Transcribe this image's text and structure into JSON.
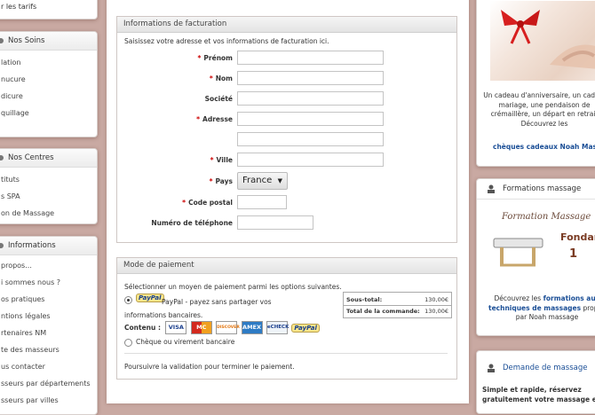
{
  "left": {
    "top_fragment": "r les tarifs",
    "soins": {
      "title": "Nos Soins",
      "items": [
        "lation",
        "nucure",
        "dicure",
        "quillage"
      ]
    },
    "centres": {
      "title": "Nos Centres",
      "items": [
        "tituts",
        "s SPA",
        "on de Massage"
      ]
    },
    "informations": {
      "title": "Informations",
      "items": [
        "propos...",
        "i sommes nous ?",
        "os pratiques",
        "ntions légales",
        "rtenaires NM",
        "te des masseurs",
        "us contacter",
        "sseurs par départements",
        "sseurs par villes"
      ]
    }
  },
  "billing": {
    "title": "Informations de facturation",
    "intro": "Saisissez votre adresse et vos informations de facturation ici.",
    "required_mark": "*",
    "fields": {
      "prenom": "Prénom",
      "nom": "Nom",
      "societe": "Société",
      "adresse": "Adresse",
      "ville": "Ville",
      "pays": "Pays",
      "pays_value": "France",
      "code_postal": "Code postal",
      "telephone": "Numéro de téléphone"
    }
  },
  "payment": {
    "title": "Mode de paiement",
    "intro": "Sélectionner un moyen de paiement parmi les options suivantes.",
    "paypal_logo": "PayPal",
    "paypal_text": "PayPal - payez sans partager vos informations bancaires.",
    "contenu_label": "Contenu :",
    "cards": [
      "VISA",
      "MC",
      "DISCOVER",
      "AMEX",
      "eCHECK"
    ],
    "cheque_label": "Chèque ou virement bancaire",
    "continue_text": "Poursuivre la validation pour terminer le paiement.",
    "summary": {
      "subtotal_label": "Sous-total:",
      "subtotal_value": "130,00€",
      "total_label": "Total de la commande:",
      "total_value": "130,00€"
    }
  },
  "right": {
    "gift_text": "Un cadeau d'anniversaire, un cad de mariage, une pendaison de crémaillère, un départ en retrait Découvrez les",
    "gift_link": "chèques cadeaux Noah Massa",
    "formations": {
      "title": "Formations massage",
      "banner_title": "Formation Massage",
      "banner_sub": "Fondament",
      "banner_num": "1",
      "text_pre": "Découvrez les",
      "link": "formations aux techniques de massages",
      "text_post": "propos par Noah massage"
    },
    "demande": {
      "title": "Demande de massage",
      "text": "Simple et rapide, réservez gratuitement votre massage en"
    }
  }
}
